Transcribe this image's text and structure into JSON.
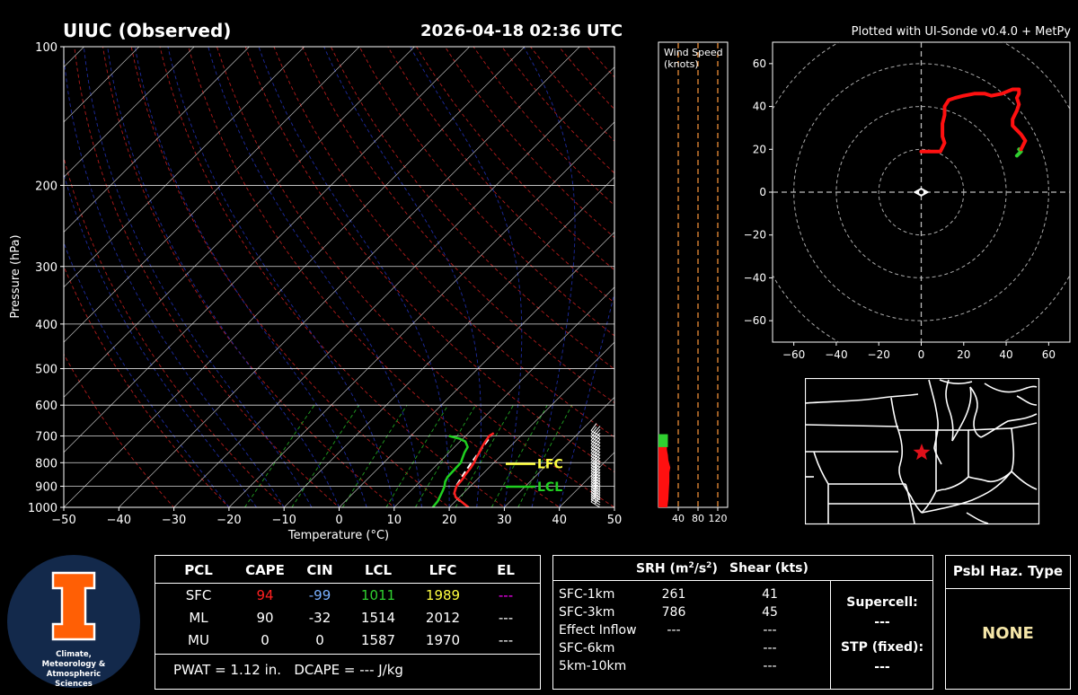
{
  "header": {
    "title": "UIUC (Observed)",
    "datetime": "2026-04-18 02:36 UTC",
    "credit": "Plotted with UI-Sonde v0.4.0 + MetPy"
  },
  "chart_data": [
    {
      "type": "line",
      "name": "skew-t",
      "ylabel": "Pressure (hPa)",
      "xlabel": "Temperature (°C)",
      "xlim": [
        -50,
        50
      ],
      "ylim": [
        1000,
        100
      ],
      "y_scale": "log",
      "skew": true,
      "x_ticks": [
        "−50",
        "−40",
        "−30",
        "−20",
        "−10",
        "0",
        "10",
        "20",
        "30",
        "40",
        "50"
      ],
      "y_ticks": [
        100,
        200,
        300,
        400,
        500,
        600,
        700,
        800,
        900,
        1000
      ],
      "colors": {
        "temperature": "#ff2020",
        "dewpoint": "#20d020",
        "parcel": "#ffffff",
        "dry_adiabat": "#d02020",
        "moist_adiabat": "#2030b0",
        "mixing_ratio": "#20a020",
        "lfc": "#ffff40",
        "lcl": "#20d020"
      },
      "temperature": [
        [
          1000,
          23.5
        ],
        [
          970,
          21.0
        ],
        [
          950,
          19.3
        ],
        [
          930,
          18.3
        ],
        [
          900,
          17.5
        ],
        [
          870,
          17.3
        ],
        [
          850,
          17.0
        ],
        [
          820,
          16.7
        ],
        [
          800,
          16.4
        ],
        [
          780,
          15.9
        ],
        [
          760,
          15.5
        ],
        [
          740,
          15.0
        ],
        [
          720,
          14.6
        ],
        [
          700,
          14.3
        ],
        [
          690,
          14.6
        ]
      ],
      "dewpoint": [
        [
          1000,
          17.0
        ],
        [
          970,
          16.8
        ],
        [
          950,
          16.4
        ],
        [
          920,
          15.8
        ],
        [
          900,
          15.3
        ],
        [
          880,
          14.6
        ],
        [
          860,
          14.2
        ],
        [
          830,
          14.1
        ],
        [
          800,
          14.0
        ],
        [
          780,
          13.4
        ],
        [
          760,
          12.8
        ],
        [
          740,
          12.4
        ],
        [
          720,
          11.0
        ],
        [
          710,
          9.5
        ],
        [
          700,
          7.0
        ]
      ],
      "parcel": [
        [
          1000,
          23.5
        ],
        [
          960,
          20.0
        ],
        [
          940,
          18.6
        ],
        [
          900,
          17.4
        ],
        [
          850,
          16.6
        ],
        [
          800,
          15.9
        ],
        [
          760,
          15.4
        ],
        [
          720,
          14.9
        ],
        [
          700,
          14.6
        ]
      ],
      "levels": [
        {
          "label": "LFC",
          "pressure": 805,
          "color": "#ffff40"
        },
        {
          "label": "LCL",
          "pressure": 902,
          "color": "#20d020"
        }
      ]
    },
    {
      "type": "bar",
      "name": "wind-speed-profile",
      "title": "Wind Speed\n(knots)",
      "x_ticks": [
        40,
        80,
        120
      ],
      "xlim": [
        0,
        140
      ],
      "profile": [
        [
          1000,
          18
        ],
        [
          960,
          20
        ],
        [
          920,
          21
        ],
        [
          880,
          22
        ],
        [
          840,
          22
        ],
        [
          820,
          24
        ],
        [
          790,
          20
        ],
        [
          770,
          19
        ],
        [
          760,
          18
        ],
        [
          750,
          17
        ],
        [
          740,
          17
        ],
        [
          730,
          17
        ],
        [
          720,
          18
        ],
        [
          700,
          19
        ]
      ],
      "colors": {
        "low": "#ff1010",
        "high": "#30d030",
        "reference": "#ff9a3c"
      }
    },
    {
      "type": "line",
      "name": "hodograph",
      "xlim": [
        -70,
        70
      ],
      "ylim": [
        -70,
        70
      ],
      "x_ticks": [
        "−60",
        "−40",
        "−20",
        "0",
        "20",
        "40",
        "60"
      ],
      "y_ticks": [
        "60",
        "40",
        "20",
        "0",
        "−20",
        "−40",
        "−60"
      ],
      "rings": [
        10,
        20,
        30,
        40,
        50,
        60,
        70
      ],
      "segments": [
        {
          "color": "#30d030",
          "points": [
            [
              45,
              17
            ],
            [
              46,
              18
            ],
            [
              47,
              19
            ],
            [
              46,
              20
            ]
          ]
        },
        {
          "color": "#ff1010",
          "points": [
            [
              47,
              20
            ],
            [
              48,
              22
            ],
            [
              49,
              24
            ],
            [
              47,
              27
            ],
            [
              45,
              29
            ],
            [
              43,
              31
            ],
            [
              43,
              34
            ],
            [
              44,
              36
            ],
            [
              45,
              38
            ],
            [
              46,
              41
            ],
            [
              45,
              44
            ],
            [
              46,
              46
            ],
            [
              46,
              48
            ],
            [
              43,
              48
            ],
            [
              38,
              46
            ],
            [
              33,
              45
            ],
            [
              30,
              46
            ],
            [
              27,
              46
            ],
            [
              25,
              46
            ],
            [
              20,
              45
            ],
            [
              16,
              44
            ],
            [
              13,
              43
            ],
            [
              11,
              40
            ],
            [
              11,
              36
            ],
            [
              10,
              32
            ],
            [
              10,
              28
            ],
            [
              10,
              26
            ],
            [
              11,
              23
            ],
            [
              9,
              19
            ],
            [
              4,
              19
            ],
            [
              0,
              19
            ]
          ]
        }
      ],
      "storm_marker": [
        0,
        0
      ]
    }
  ],
  "params_table": {
    "headers": [
      "PCL",
      "CAPE",
      "CIN",
      "LCL",
      "LFC",
      "EL"
    ],
    "rows": [
      {
        "pcl": "SFC",
        "cape": "94",
        "cin": "-99",
        "lcl": "1011",
        "lfc": "1989",
        "el": "---"
      },
      {
        "pcl": "ML",
        "cape": "90",
        "cin": "-32",
        "lcl": "1514",
        "lfc": "2012",
        "el": "---"
      },
      {
        "pcl": "MU",
        "cape": "0",
        "cin": "0",
        "lcl": "1587",
        "lfc": "1970",
        "el": "---"
      }
    ],
    "sfc_colors": {
      "cape": "#ff2020",
      "cin": "#7ab0ff",
      "lcl": "#30d030",
      "lfc": "#ffff40",
      "el": "#ff00ff"
    },
    "footer": "PWAT = 1.12 in.   DCAPE = --- J/kg"
  },
  "kinematics": {
    "header_srh": "SRH (m",
    "header_srh_sup1": "2",
    "header_srh_mid": "/s",
    "header_srh_sup2": "2",
    "header_srh_end": ")",
    "header_shear": "Shear (kts)",
    "rows": [
      {
        "layer": "SFC-1km",
        "srh": "261",
        "shear": "41"
      },
      {
        "layer": "SFC-3km",
        "srh": "786",
        "shear": "45"
      },
      {
        "layer": "Effect Inflow",
        "srh": "---",
        "shear": "---"
      },
      {
        "layer": "SFC-6km",
        "srh": "",
        "shear": "---"
      },
      {
        "layer": "5km-10km",
        "srh": "",
        "shear": "---"
      }
    ],
    "supercell_label": "Supercell:",
    "supercell_value": "---",
    "stp_label": "STP (fixed):",
    "stp_value": "---"
  },
  "hazard": {
    "title": "Psbl Haz. Type",
    "value": "NONE"
  },
  "logo": {
    "letter": "I",
    "caption_lines": [
      "Climate,",
      "Meteorology &",
      "Atmospheric",
      "Sciences"
    ],
    "colors": {
      "background": "#13294b",
      "letter": "#ff5f05"
    }
  },
  "map": {
    "marker": "star",
    "marker_color": "#e0101a"
  }
}
